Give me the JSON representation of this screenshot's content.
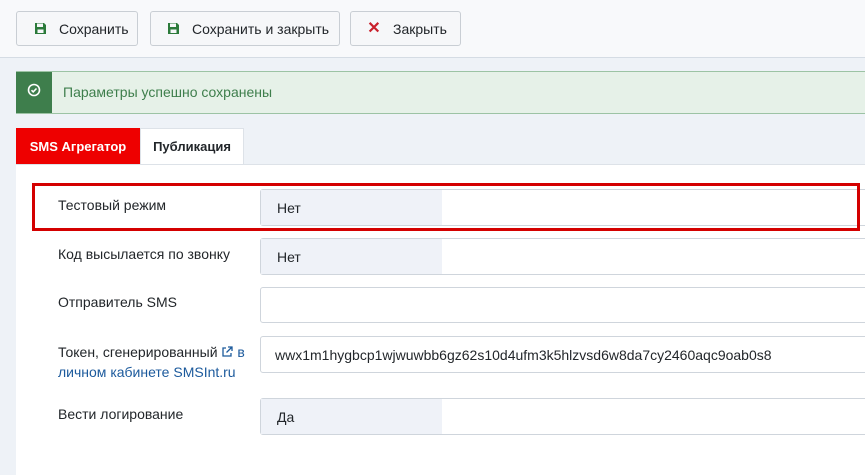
{
  "toolbar": {
    "save_label": "Сохранить",
    "save_close_label": "Сохранить и закрыть",
    "close_label": "Закрыть"
  },
  "alert": {
    "message": "Параметры успешно сохранены"
  },
  "tabs": [
    {
      "label": "SMS Агрегатор",
      "active": true
    },
    {
      "label": "Публикация",
      "active": false
    }
  ],
  "fields": {
    "test_mode": {
      "label": "Тестовый режим",
      "value": "Нет"
    },
    "call_code": {
      "label": "Код высылается по звонку",
      "value": "Нет"
    },
    "sender": {
      "label": "Отправитель SMS",
      "value": ""
    },
    "token": {
      "label_prefix": "Токен, сгенерированный",
      "label_link": "в личном кабинете SMSInt.ru",
      "value": "wwx1m1hygbcp1wjwuwbb6gz62s10d4ufm3k5hlzvsd6w8da7cy2460aqc9oab0s8"
    },
    "logging": {
      "label": "Вести логирование",
      "value": "Да"
    }
  },
  "colors": {
    "accent": "#ee0000",
    "success": "#3e7e4c",
    "link": "#1c5a9c",
    "highlight": "#d40000"
  }
}
